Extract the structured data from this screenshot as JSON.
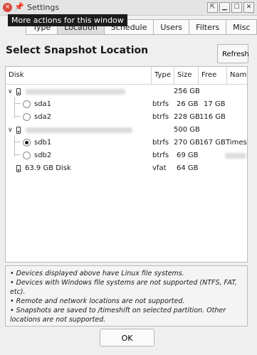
{
  "window": {
    "title": "Settings",
    "close_glyph": "×",
    "buttons": [
      "⇱",
      "▁",
      "☐",
      "✕"
    ]
  },
  "tooltip": "More actions for this window",
  "tabs": [
    {
      "label": "Type"
    },
    {
      "label": "Location"
    },
    {
      "label": "Schedule"
    },
    {
      "label": "Users"
    },
    {
      "label": "Filters"
    },
    {
      "label": "Misc"
    }
  ],
  "heading": "Select Snapshot Location",
  "refresh_label": "Refresh",
  "table": {
    "columns": {
      "disk": "Disk",
      "type": "Type",
      "size": "Size",
      "free": "Free",
      "name": "Name"
    },
    "rows": [
      {
        "disk": "",
        "type": "",
        "size": "256 GB",
        "free": "",
        "name": ""
      },
      {
        "disk": "sda1",
        "type": "btrfs",
        "size": "26 GB",
        "free": "17 GB",
        "name": ""
      },
      {
        "disk": "sda2",
        "type": "btrfs",
        "size": "228 GB",
        "free": "116 GB",
        "name": ""
      },
      {
        "disk": "",
        "type": "",
        "size": "500 GB",
        "free": "",
        "name": ""
      },
      {
        "disk": "sdb1",
        "type": "btrfs",
        "size": "270 GB",
        "free": "167 GB",
        "name": "Timesh"
      },
      {
        "disk": "sdb2",
        "type": "btrfs",
        "size": "69 GB",
        "free": "",
        "name": ""
      },
      {
        "disk": "63.9 GB Disk",
        "type": "vfat",
        "size": "64 GB",
        "free": "",
        "name": ""
      }
    ]
  },
  "notes": [
    "• Devices displayed above have Linux file systems.",
    "• Devices with Windows file systems are not supported (NTFS, FAT, etc).",
    "• Remote and network locations are not supported.",
    "• Snapshots are saved to /timeshift on selected partition. Other locations are not supported."
  ],
  "ok_label": "OK"
}
